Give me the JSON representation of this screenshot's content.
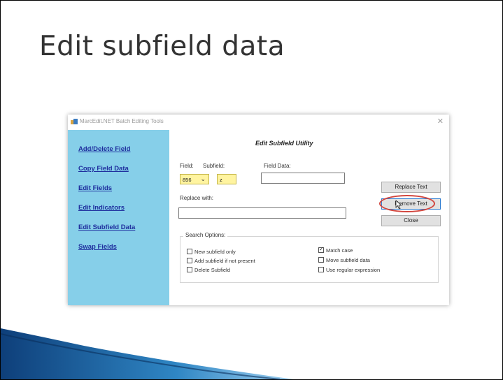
{
  "slide": {
    "title": "Edit subfield data"
  },
  "window": {
    "title": "MarcEdit.NET Batch Editing Tools",
    "close_glyph": "✕"
  },
  "sidebar": {
    "items": [
      {
        "label": "Add/Delete Field"
      },
      {
        "label": "Copy Field Data"
      },
      {
        "label": "Edit Fields"
      },
      {
        "label": "Edit Indicators"
      },
      {
        "label": "Edit Subfield Data"
      },
      {
        "label": "Swap Fields"
      }
    ]
  },
  "utility": {
    "title": "Edit Subfield Utility",
    "field_label": "Field:",
    "field_value": "856",
    "subfield_label": "Subfield:",
    "subfield_value": "z",
    "field_data_label": "Field Data:",
    "field_data_value": "",
    "replace_label": "Replace with:",
    "replace_value": ""
  },
  "buttons": {
    "replace": "Replace Text",
    "remove": "Remove Text",
    "close": "Close"
  },
  "options": {
    "legend": "Search Options:",
    "items": [
      {
        "label": "New subfield only",
        "checked": false
      },
      {
        "label": "Add subfield if not present",
        "checked": false
      },
      {
        "label": "Delete Subfield",
        "checked": false
      },
      {
        "label": "Match case",
        "checked": true
      },
      {
        "label": "Move subfield data",
        "checked": false
      },
      {
        "label": "Use regular expression",
        "checked": false
      }
    ]
  },
  "colors": {
    "sidebar": "#86cfe9",
    "link": "#1f2f9e",
    "highlight": "#fff4a0",
    "annotation": "#d2453d",
    "deco_dark": "#0e3f7a",
    "deco_light": "#2f86c4"
  }
}
